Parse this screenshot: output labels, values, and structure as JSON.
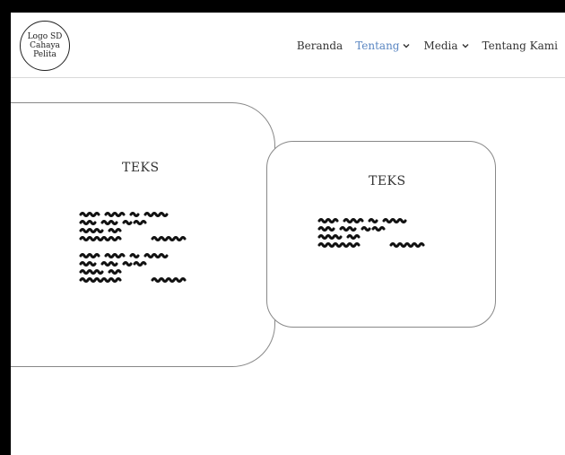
{
  "header": {
    "logo_text": "Logo SD\nCahaya Pelita",
    "nav": [
      {
        "label": "Beranda",
        "dropdown": false,
        "active": false
      },
      {
        "label": "Tentang",
        "dropdown": true,
        "active": true
      },
      {
        "label": "Media",
        "dropdown": true,
        "active": false
      },
      {
        "label": "Tentang Kami",
        "dropdown": false,
        "active": false
      }
    ]
  },
  "cards": [
    {
      "title": "TEKS"
    },
    {
      "title": "TEKS"
    }
  ],
  "colors": {
    "active_nav": "#5a86c2",
    "frame": "#000000",
    "text": "#333333"
  }
}
